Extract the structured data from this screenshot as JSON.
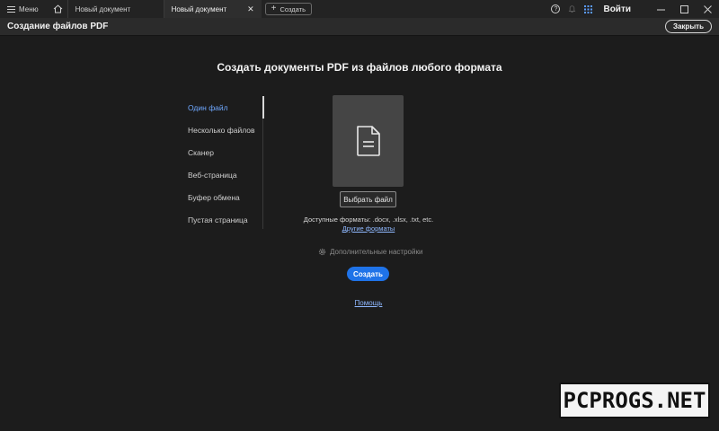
{
  "tabbar": {
    "menu_label": "Меню",
    "tabs": [
      {
        "label": "Новый документ"
      },
      {
        "label": "Новый документ"
      }
    ],
    "new_tab_label": "Создать",
    "help_icon_glyph": "?",
    "signin_label": "Войти"
  },
  "header": {
    "title": "Создание файлов PDF",
    "close_label": "Закрыть"
  },
  "main": {
    "title": "Создать документы PDF из файлов любого формата",
    "side_items": [
      {
        "label": "Один файл",
        "active": true
      },
      {
        "label": "Несколько файлов",
        "active": false
      },
      {
        "label": "Сканер",
        "active": false
      },
      {
        "label": "Веб-страница",
        "active": false
      },
      {
        "label": "Буфер обмена",
        "active": false
      },
      {
        "label": "Пустая страница",
        "active": false
      }
    ],
    "choose_file_label": "Выбрать файл",
    "formats_label": "Доступные форматы:",
    "formats_value": ".docx, .xlsx, .txt, etc.",
    "other_formats_label": "Другие форматы",
    "advanced_settings_label": "Дополнительные настройки",
    "create_label": "Создать",
    "help_label": "Помощь"
  },
  "watermark": "PCPROGS.NET",
  "colors": {
    "accent": "#1f73e8",
    "active_item": "#6fa8ff",
    "link": "#8fb8ff",
    "background": "#1c1c1c"
  }
}
